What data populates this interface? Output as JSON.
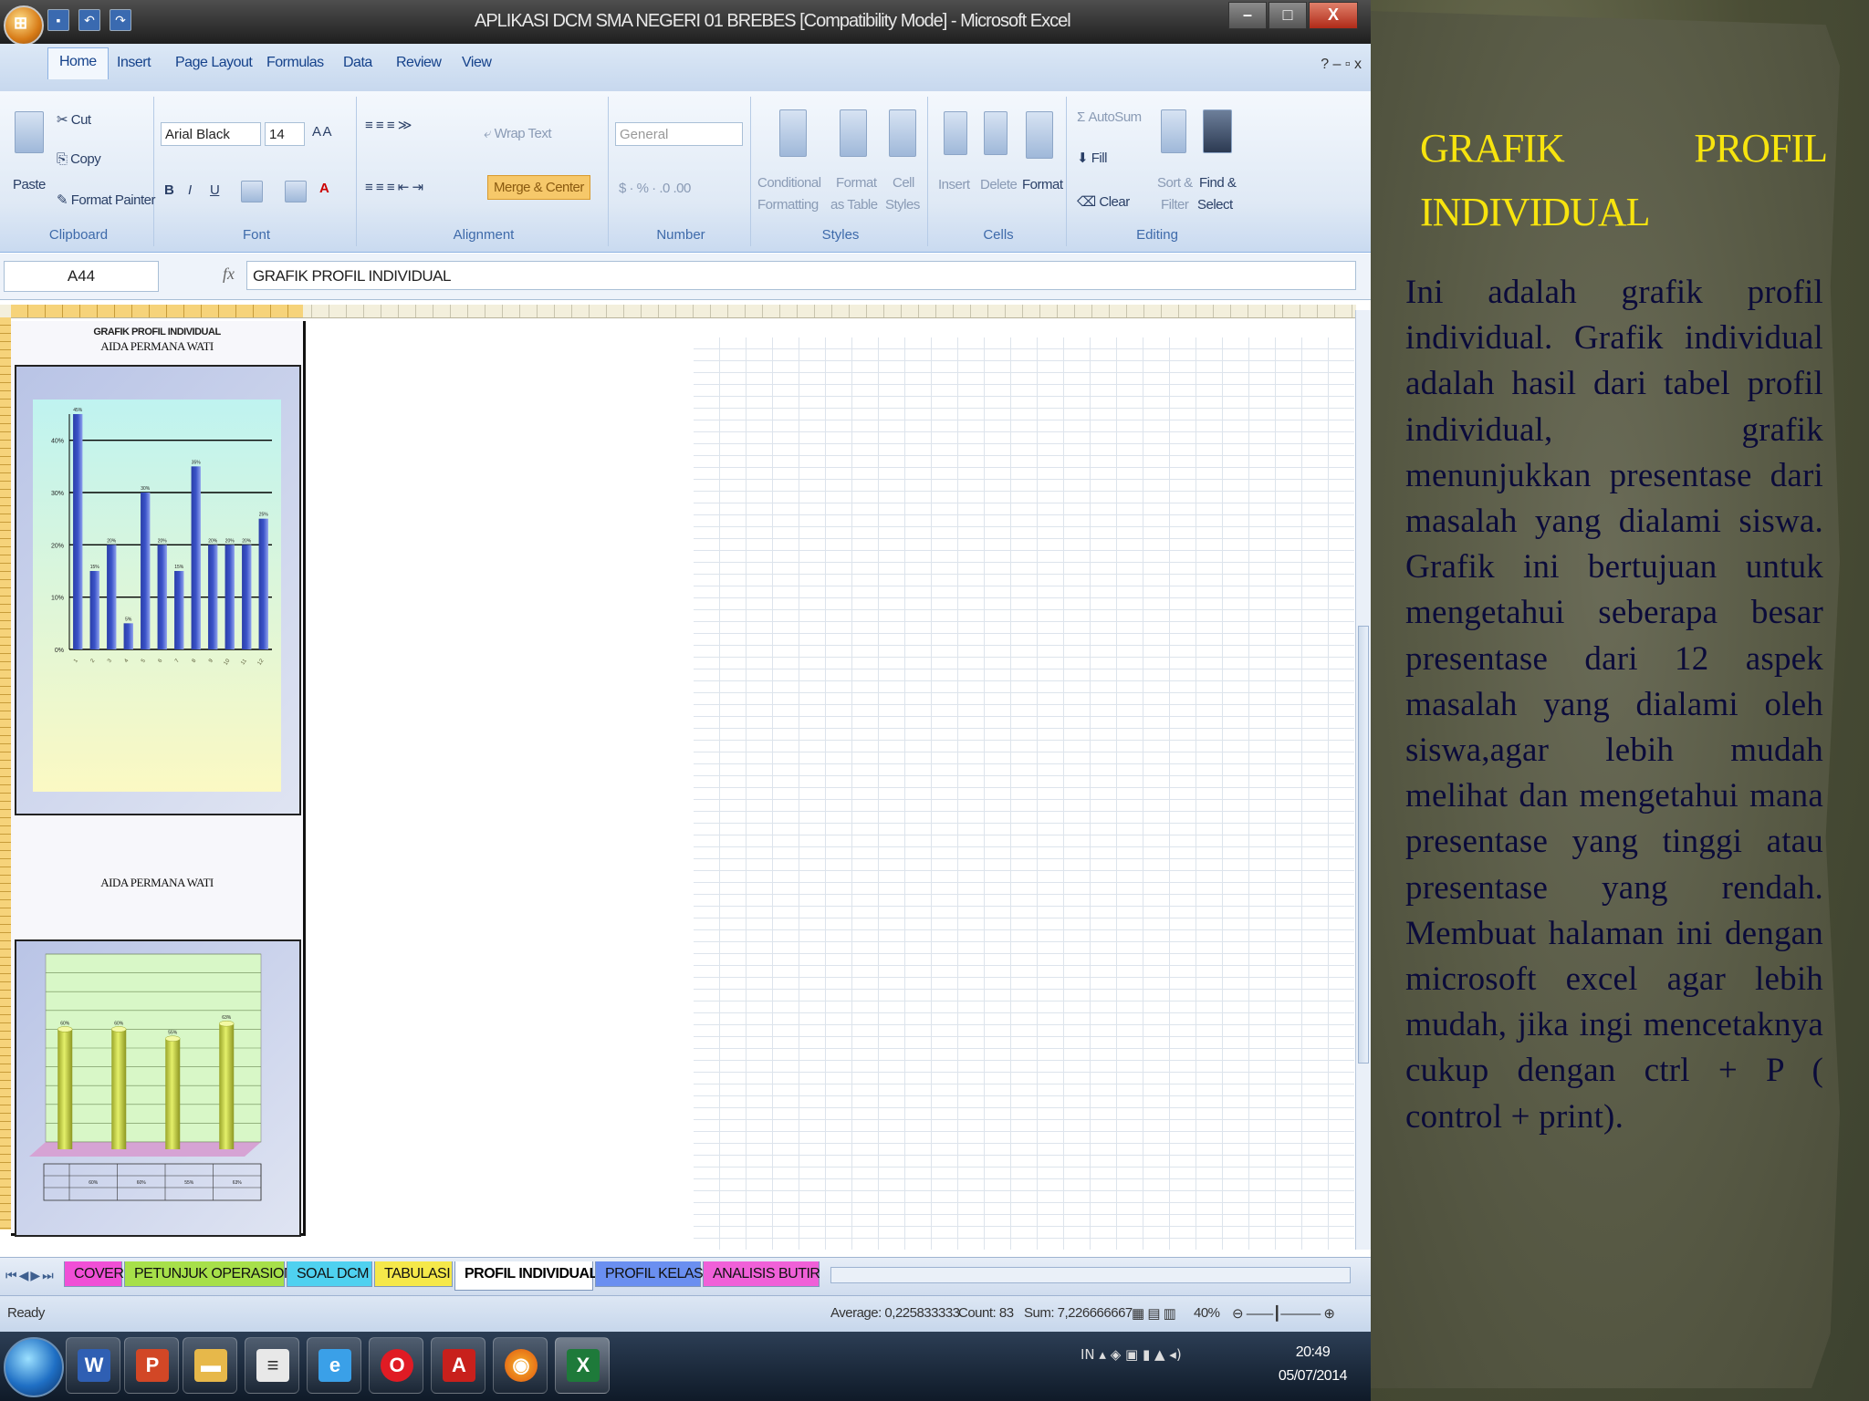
{
  "window": {
    "title": "APLIKASI DCM SMA NEGERI 01 BREBES [Compatibility Mode] - Microsoft Excel",
    "minimize": "–",
    "maximize": "□",
    "close": "X"
  },
  "ribbon_tabs": [
    "Home",
    "Insert",
    "Page Layout",
    "Formulas",
    "Data",
    "Review",
    "View"
  ],
  "ribbon": {
    "clipboard": {
      "paste": "Paste",
      "cut": "Cut",
      "copy": "Copy",
      "format_painter": "Format Painter",
      "label": "Clipboard"
    },
    "font": {
      "name": "Arial Black",
      "size": "14",
      "label": "Font"
    },
    "alignment": {
      "wrap_text": "Wrap Text",
      "merge_center": "Merge & Center",
      "label": "Alignment"
    },
    "number": {
      "format": "General",
      "label": "Number"
    },
    "styles": {
      "conditional": "Conditional",
      "formatting": "Formatting",
      "format_as": "Format",
      "as_table": "as Table",
      "cell": "Cell",
      "styles_btn": "Styles",
      "label": "Styles"
    },
    "cells": {
      "insert": "Insert",
      "delete": "Delete",
      "format": "Format",
      "label": "Cells"
    },
    "editing": {
      "autosum": "AutoSum",
      "fill": "Fill",
      "clear": "Clear",
      "sort": "Sort &",
      "filter": "Filter",
      "find": "Find &",
      "select": "Select",
      "label": "Editing"
    }
  },
  "formula_bar": {
    "cell_ref": "A44",
    "fx": "fx",
    "content": "GRAFIK PROFIL INDIVIDUAL"
  },
  "sheet": {
    "chart1_title": "GRAFIK PROFIL INDIVIDUAL",
    "chart1_name": "AIDA PERMANA WATI",
    "chart2_name": "AIDA PERMANA WATI"
  },
  "chart_data": [
    {
      "type": "bar",
      "title": "GRAFIK PROFIL INDIVIDUAL",
      "subtitle": "AIDA PERMANA WATI",
      "categories": [
        "1",
        "2",
        "3",
        "4",
        "5",
        "6",
        "7",
        "8",
        "9",
        "10",
        "11",
        "12"
      ],
      "values": [
        45,
        15,
        20,
        5,
        30,
        20,
        15,
        35,
        20,
        20,
        20,
        25
      ],
      "yticks": [
        "0%",
        "10%",
        "20%",
        "30%",
        "40%"
      ],
      "ylim": [
        0,
        45
      ],
      "colors": {
        "bar": "#3b53c8",
        "plot_bg_top": "#bff3f0",
        "plot_bg_bottom": "#fbf9c3"
      }
    },
    {
      "type": "bar",
      "subtitle": "AIDA PERMANA WATI",
      "categories": [
        "1",
        "2",
        "3",
        "4"
      ],
      "values": [
        60,
        60,
        55,
        63
      ],
      "ylim": [
        0,
        100
      ],
      "colors": {
        "bar": "#e4f06a",
        "plot_bg": "#d8f7c7",
        "floor": "#d6a3d4"
      }
    }
  ],
  "sheet_tabs": [
    {
      "label": "COVER",
      "color": "#f04fd6"
    },
    {
      "label": "PETUNJUK OPERASIONAL",
      "color": "#a7e04a"
    },
    {
      "label": "SOAL DCM",
      "color": "#4fd1f0"
    },
    {
      "label": "TABULASI",
      "color": "#f5e84a"
    },
    {
      "label": "PROFIL INDIVIDUAL",
      "color": "#ffffff"
    },
    {
      "label": "PROFIL KELAS",
      "color": "#6a8ff0"
    },
    {
      "label": "ANALISIS BUTIR",
      "color": "#f060d8"
    }
  ],
  "status": {
    "ready": "Ready",
    "average": "Average: 0,225833333",
    "count": "Count: 83",
    "sum": "Sum: 7,226666667",
    "zoom": "40%"
  },
  "taskbar": {
    "time": "20:49",
    "date": "05/07/2014",
    "lang": "IN"
  },
  "slide": {
    "heading": "GRAFIK PROFIL INDIVIDUAL",
    "body": "Ini adalah grafik profil individual. Grafik individual adalah hasil dari tabel profil individual, grafik menunjukkan presentase dari masalah yang dialami siswa. Grafik ini bertujuan untuk mengetahui seberapa besar presentase dari 12 aspek masalah yang dialami oleh siswa,agar lebih mudah melihat dan mengetahui mana presentase yang tinggi atau presentase yang rendah. Membuat halaman ini dengan microsoft excel agar lebih mudah, jika ingi mencetaknya cukup dengan ctrl + P ( control + print).",
    "colors": {
      "heading": "#f7e40e",
      "body": "#0b0b3a"
    }
  }
}
